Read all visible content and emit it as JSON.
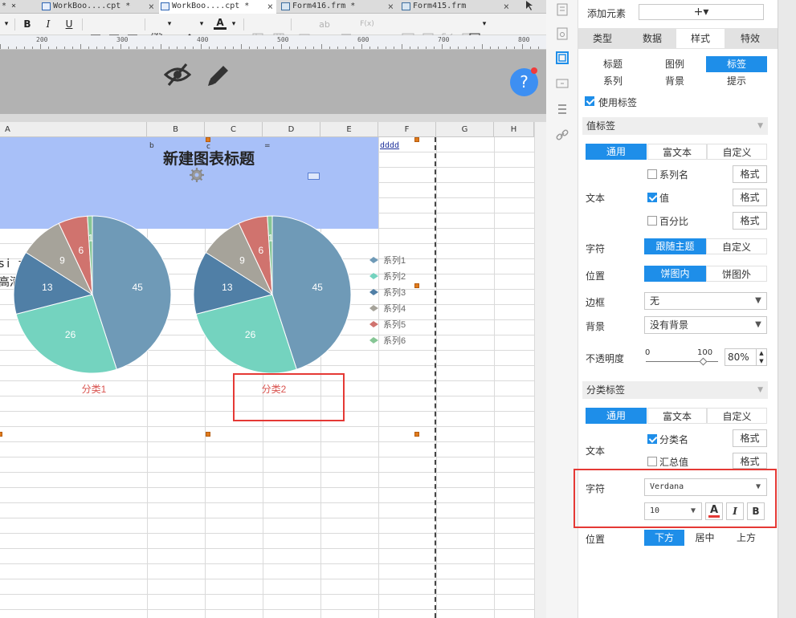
{
  "tabs": [
    {
      "label": "* ×",
      "active": false
    },
    {
      "label": "WorkBoo....cpt *",
      "active": false
    },
    {
      "label": "WorkBoo....cpt *",
      "active": true
    },
    {
      "label": "Form416.frm *",
      "active": false
    },
    {
      "label": "Form415.frm",
      "active": false
    }
  ],
  "toolbar": {
    "bold": "B",
    "italic": "I",
    "underline": "U",
    "text_color": "A",
    "ab": "ab",
    "fx": "F(x)"
  },
  "ruler": {
    "marks": [
      "200",
      "300",
      "400",
      "500",
      "600",
      "700",
      "800"
    ]
  },
  "form": {
    "help": "?"
  },
  "columns": [
    "A",
    "B",
    "C",
    "D",
    "E",
    "F",
    "G",
    "H"
  ],
  "sheet": {
    "chart_title": "新建图表标题",
    "cell_f": "dddd",
    "left_text_1": "si z",
    "left_text_2": "高清",
    "small_b": "b",
    "small_c": "c",
    "small_eq": "="
  },
  "chart_data": [
    {
      "type": "pie",
      "category": "分类1",
      "slices": [
        {
          "series": "系列1",
          "value": 45,
          "color": "#6f9ab7"
        },
        {
          "series": "系列2",
          "value": 26,
          "color": "#74d3bf"
        },
        {
          "series": "系列3",
          "value": 13,
          "color": "#507fa6"
        },
        {
          "series": "系列4",
          "value": 9,
          "color": "#a6a39a"
        },
        {
          "series": "系列5",
          "value": 6,
          "color": "#d0736e"
        },
        {
          "series": "系列6",
          "value": 1,
          "color": "#86c695"
        }
      ]
    },
    {
      "type": "pie",
      "category": "分类2",
      "slices": [
        {
          "series": "系列1",
          "value": 45,
          "color": "#6f9ab7"
        },
        {
          "series": "系列2",
          "value": 26,
          "color": "#74d3bf"
        },
        {
          "series": "系列3",
          "value": 13,
          "color": "#507fa6"
        },
        {
          "series": "系列4",
          "value": 9,
          "color": "#a6a39a"
        },
        {
          "series": "系列5",
          "value": 6,
          "color": "#d0736e"
        },
        {
          "series": "系列6",
          "value": 1,
          "color": "#86c695"
        }
      ]
    }
  ],
  "legend": [
    "系列1",
    "系列2",
    "系列3",
    "系列4",
    "系列5",
    "系列6"
  ],
  "panel": {
    "add_element": "添加元素",
    "add_symbol": "+▾",
    "main_tabs": [
      "类型",
      "数据",
      "样式",
      "特效"
    ],
    "sub_tabs": [
      "标题",
      "图例",
      "标签",
      "系列",
      "背景",
      "提示"
    ],
    "use_label": "使用标签",
    "value_label_section": "值标签",
    "mode_tabs": [
      "通用",
      "富文本",
      "自定义"
    ],
    "text_label": "文本",
    "series_name": "系列名",
    "value": "值",
    "percent": "百分比",
    "format": "格式",
    "font_label": "字符",
    "follow_theme": "跟随主题",
    "custom": "自定义",
    "position_label": "位置",
    "inside_pie": "饼图内",
    "outside_pie": "饼图外",
    "border_label": "边框",
    "border_value": "无",
    "background_label": "背景",
    "background_value": "没有背景",
    "opacity_label": "不透明度",
    "opacity_min": "0",
    "opacity_max": "100",
    "opacity_value": "80%",
    "category_label_section": "分类标签",
    "category_name": "分类名",
    "total_value": "汇总值",
    "font_name": "Verdana",
    "font_size": "10",
    "color_btn": "A",
    "italic_btn": "I",
    "bold_btn": "B",
    "position_tabs": [
      "下方",
      "居中",
      "上方"
    ]
  },
  "colors": {
    "accent": "#1e8ee9",
    "highlight": "#e53935",
    "title_band": "#a8c0f8",
    "category_text": "#d9534f"
  }
}
